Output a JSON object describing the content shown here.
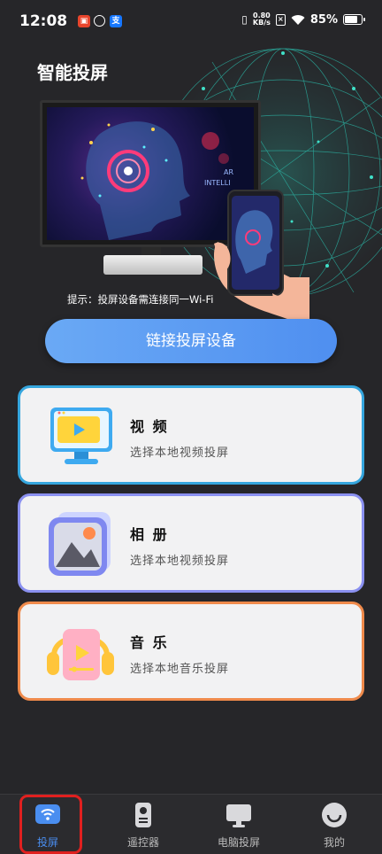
{
  "status_bar": {
    "time": "12:08",
    "net_speed_value": "0.80",
    "net_speed_unit": "KB/s",
    "battery": "85%",
    "battery_level": 0.85,
    "icons": [
      "notification-red-icon",
      "app-blue-icon",
      "alipay-icon",
      "vibrate-icon",
      "data-saver-icon",
      "wifi-icon",
      "battery-icon"
    ]
  },
  "hero": {
    "title": "智能投屏",
    "tv_overlay_text_1": "AR",
    "tv_overlay_text_2": "INTELLI",
    "hint": "提示：投屏设备需连接同一Wi-Fi"
  },
  "connect_button": {
    "label": "链接投屏设备"
  },
  "cards": [
    {
      "title": "视 频",
      "subtitle": "选择本地视频投屏",
      "icon": "video-monitor-icon",
      "border": "#35a6de"
    },
    {
      "title": "相 册",
      "subtitle": "选择本地视频投屏",
      "icon": "photo-album-icon",
      "border": "#8a90f0"
    },
    {
      "title": "音 乐",
      "subtitle": "选择本地音乐投屏",
      "icon": "music-headphones-icon",
      "border": "#ef8a4b"
    }
  ],
  "bottom_nav": [
    {
      "label": "投屏",
      "icon": "cast-icon",
      "active": true
    },
    {
      "label": "遥控器",
      "icon": "remote-icon",
      "active": false
    },
    {
      "label": "电脑投屏",
      "icon": "desktop-icon",
      "active": false
    },
    {
      "label": "我的",
      "icon": "profile-icon",
      "active": false
    }
  ],
  "colors": {
    "background": "#262629",
    "accent": "#4a8ef0",
    "highlight_outline": "#e0201f"
  }
}
